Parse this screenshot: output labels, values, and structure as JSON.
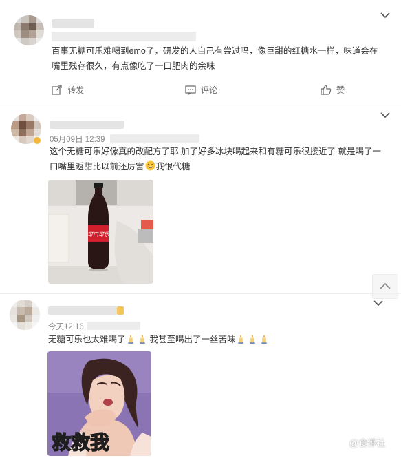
{
  "comments": [
    {
      "username": "",
      "timestamp": "",
      "text": "百事无糖可乐难喝到emo了，研发的人自己有尝过吗，像巨甜的红糖水一样，味道会在嘴里残存很久，有点像吃了一口肥肉的余味",
      "text_line1": "百事无糖可乐难喝到emo了，研发的人自己有尝过吗，像巨甜的红糖水一样，味道会在",
      "text_line2": "嘴里残存很久，有点像吃了一口肥肉的余味",
      "actions": {
        "repost": "转发",
        "comment": "评论",
        "like": "赞"
      }
    },
    {
      "username": "",
      "timestamp": "05月09日 12:39",
      "text_line1": "这个无糖可乐好像真的改配方了耶 加了好多冰块喝起来和有糖可乐很接近了 就是喝了一",
      "text_line2a": "口嘴里返甜比以前还厉害",
      "text_line2b": "我恨代糖",
      "image": {
        "bottle_label": "可口可乐"
      }
    },
    {
      "username": "",
      "timestamp": "今天12:16",
      "text_a": "无糖可乐也太难喝了",
      "text_b": "我甚至喝出了一丝苦味",
      "image": {
        "caption": "救救我"
      }
    }
  ],
  "watermark": "@食评社",
  "icons": {
    "repost": "repost-icon",
    "comment": "comment-icon",
    "like": "thumbs-up-icon",
    "more": "chevron-down-icon",
    "scroll_top": "chevron-up-icon",
    "emoji_sweat": "sweat-smile-emoji",
    "emoji_candle": "candle-emoji"
  },
  "colors": {
    "text": "#333333",
    "meta": "#8a8a8a",
    "action": "#666666",
    "background": "#ffffff"
  }
}
